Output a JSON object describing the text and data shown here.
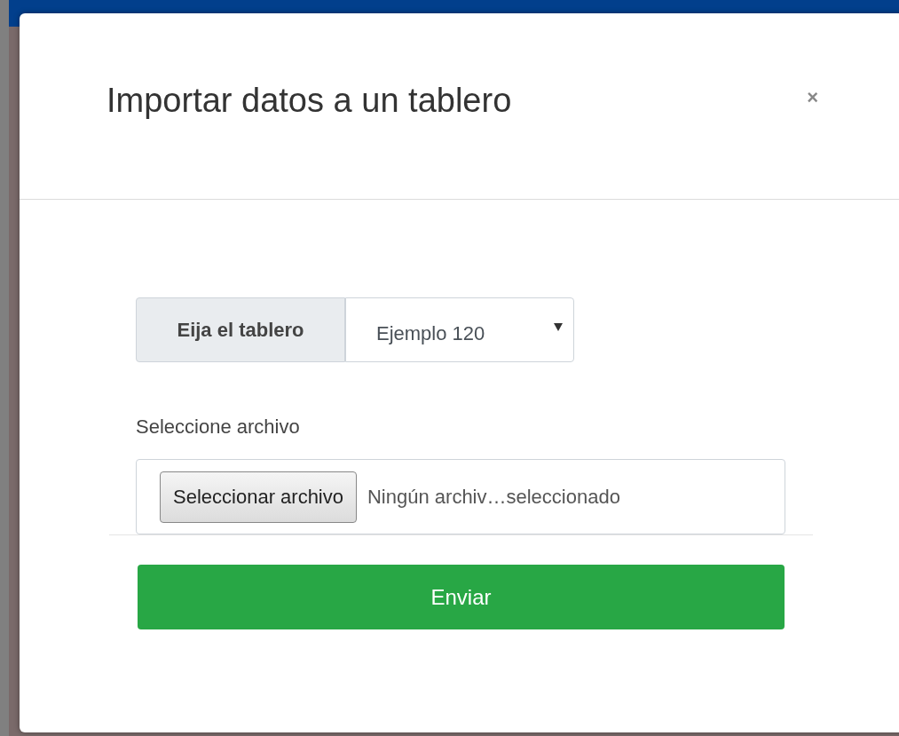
{
  "modal": {
    "title": "Importar datos a un tablero",
    "close": "×"
  },
  "board_select": {
    "label": "Eija el tablero",
    "value": "Ejemplo 120"
  },
  "file_input": {
    "label": "Seleccione archivo",
    "button": "Seleccionar archivo",
    "status": "Ningún archiv…seleccionado"
  },
  "submit": "Enviar"
}
